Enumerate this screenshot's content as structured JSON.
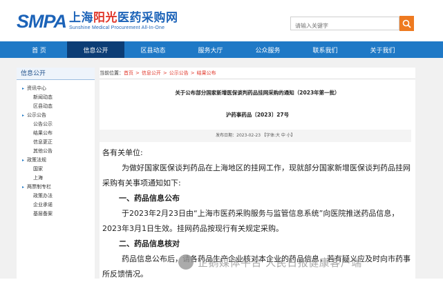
{
  "header": {
    "logo_mark": "SMPA",
    "logo_cn_1": "上海",
    "logo_cn_accent": "阳光",
    "logo_cn_2": "医药采购网",
    "logo_en": "Sunshine Medical Procurement All-In-One",
    "search_placeholder": "请输入关键字"
  },
  "nav": [
    "首 页",
    "信息公开",
    "区县动态",
    "服务大厅",
    "公众服务",
    "联系我们",
    "关于我们"
  ],
  "sidebar": {
    "title": "信息公开",
    "items": [
      {
        "type": "cat",
        "label": "资讯中心"
      },
      {
        "type": "sub",
        "label": "新闻动态"
      },
      {
        "type": "sub",
        "label": "区县动态"
      },
      {
        "type": "cat",
        "label": "公示公告"
      },
      {
        "type": "sub",
        "label": "公告公示"
      },
      {
        "type": "sub",
        "label": "结果公布"
      },
      {
        "type": "sub",
        "label": "信息更正"
      },
      {
        "type": "sub",
        "label": "其他公告"
      },
      {
        "type": "cat",
        "label": "政策法规"
      },
      {
        "type": "sub",
        "label": "国家"
      },
      {
        "type": "sub",
        "label": "上海"
      },
      {
        "type": "cat",
        "label": "两票制专栏"
      },
      {
        "type": "sub",
        "label": "政策办法"
      },
      {
        "type": "sub",
        "label": "企业承诺"
      },
      {
        "type": "sub",
        "label": "基层备案"
      }
    ]
  },
  "breadcrumb": {
    "label": "当前位置：",
    "links": [
      "首页",
      "信息公开",
      "公示公告",
      "结果公布"
    ]
  },
  "article": {
    "title": "关于公布部分国家新增医保谈判药品挂网采购的通知（2023年第一批）",
    "doc_no": "沪药事药品〔2023〕27号",
    "date_label": "发布日期：2023-02-23",
    "font_label": "【字体:大 中 小】",
    "salutation": "各有关单位:",
    "p1": "为做好国家医保谈判药品在上海地区的挂网工作，现就部分国家新增医保谈判药品挂网采购有关事项通知如下:",
    "h1": "一、药品信息公布",
    "p2": "于2023年2月23日由“上海市医药采购服务与监管信息系统”向医院推送药品信息，2023年3月1日生效。挂网药品按现行有关规定采购。",
    "h2": "二、药品信息核对",
    "p3": "药品信息公布后，请各药品生产企业核对本企业的药品信息，若有疑义应及时向市药事所反馈情况。"
  },
  "watermark": "企鹅媒体平台 人民日报健康客户端",
  "colors": {
    "nav": "#1f79c6",
    "nav_active": "#0c3d75",
    "brand": "#1c63b8",
    "accent": "#e0372a",
    "search_button": "#ee7a20"
  }
}
